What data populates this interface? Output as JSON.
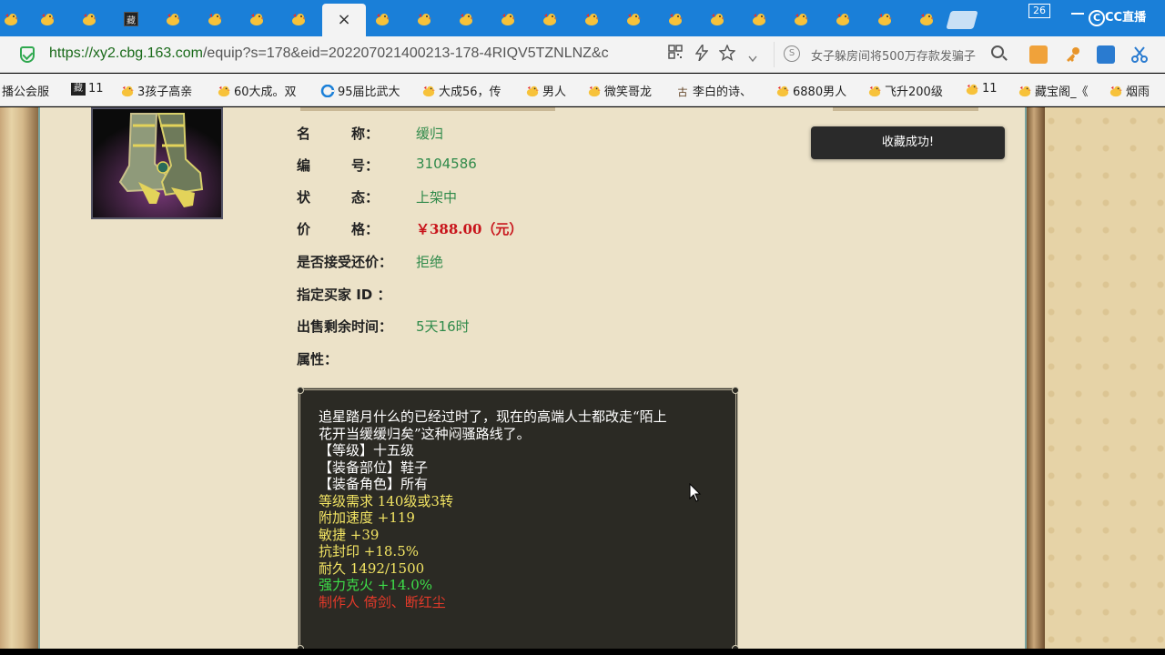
{
  "tabs": {
    "active_close": "×",
    "dark_tab_glyph": "藏"
  },
  "window": {
    "counter": "26",
    "brand": "CC直播",
    "brand_c": "C"
  },
  "address": {
    "url_host": "https://xy2.cbg.163.com",
    "url_path": "/equip?s=178&eid=202207021400213-178-4RIQV5TZNLNZ&c",
    "search_placeholder": "女子躲房间将500万存款发骗子",
    "search_engine_glyph": "S"
  },
  "bookmarks": [
    {
      "label": "播公会服"
    },
    {
      "label": "11"
    },
    {
      "label": "3孩子高亲"
    },
    {
      "label": "60大成。双"
    },
    {
      "label": "95届比武大"
    },
    {
      "label": "大成56，传"
    },
    {
      "label": "男人"
    },
    {
      "label": "微笑哥龙"
    },
    {
      "label": "李白的诗、"
    },
    {
      "label": "6880男人"
    },
    {
      "label": "飞升200级"
    },
    {
      "label": "11"
    },
    {
      "label": "藏宝阁_《"
    },
    {
      "label": "烟雨"
    }
  ],
  "bookmark_icon_glyphs": {
    "dark": "藏",
    "classic": "古"
  },
  "item": {
    "fields": [
      {
        "label": "名　　　称：",
        "value": "缓归"
      },
      {
        "label": "编　　　号：",
        "value": "3104586"
      },
      {
        "label": "状　　　态：",
        "value": "上架中"
      },
      {
        "label": "价　　　格：",
        "value": "￥388.00（元）"
      },
      {
        "label": "是否接受还价：",
        "value": "拒绝"
      },
      {
        "label": "指定买家 ID ：",
        "value": ""
      },
      {
        "label": "出售剩余时间：",
        "value": "5天16时"
      },
      {
        "label": "属性：",
        "value": ""
      }
    ],
    "toast": "收藏成功!",
    "attributes": [
      {
        "text": "追星踏月什么的已经过时了，现在的高端人士都改走“陌上",
        "color": "white"
      },
      {
        "text": "花开当缓缓归矣”这种闷骚路线了。",
        "color": "white"
      },
      {
        "text": "【等级】十五级",
        "color": "white"
      },
      {
        "text": "【装备部位】鞋子",
        "color": "white"
      },
      {
        "text": "【装备角色】所有",
        "color": "white"
      },
      {
        "text": "等级需求 140级或3转",
        "color": "yellow"
      },
      {
        "text": "附加速度 +119",
        "color": "yellow"
      },
      {
        "text": "敏捷 +39",
        "color": "yellow"
      },
      {
        "text": "抗封印 +18.5%",
        "color": "yellow"
      },
      {
        "text": "耐久 1492/1500",
        "color": "yellow"
      },
      {
        "text": "强力克火 +14.0%",
        "color": "green"
      },
      {
        "text": "制作人 倚剑、断红尘",
        "color": "red"
      }
    ]
  },
  "colors": {
    "tabstrip": "#1a7fd8",
    "price": "#c8141b",
    "value_green": "#2f8a4a",
    "attr_yellow": "#f2e463",
    "attr_green": "#3ee04a",
    "attr_red": "#e53a2a"
  },
  "icons": [
    "shield-icon",
    "lightning-icon",
    "star-icon",
    "chevron-down-icon",
    "search-icon",
    "qr-icon",
    "close-icon",
    "chick-favicon"
  ]
}
